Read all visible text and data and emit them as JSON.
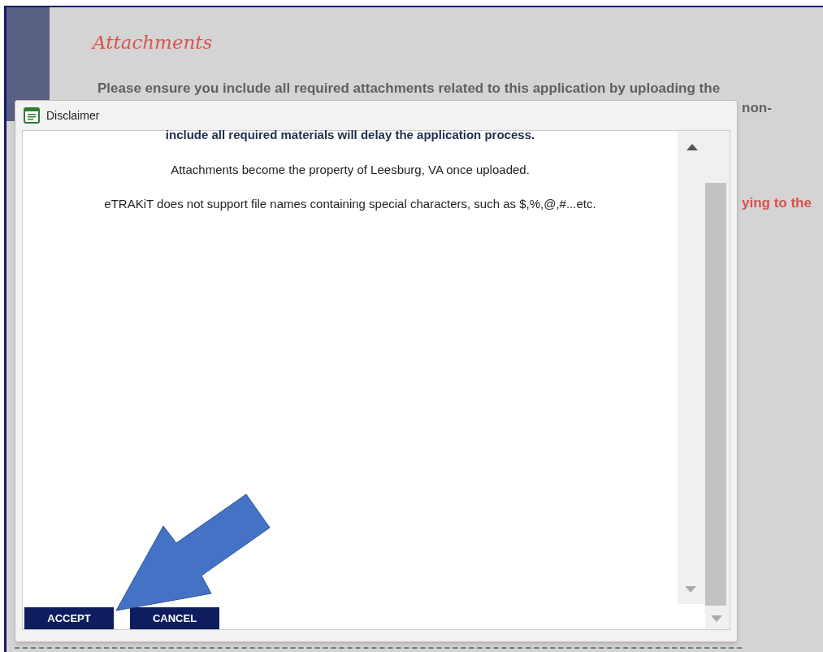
{
  "page": {
    "title": "Attachments",
    "intro_line": "Please ensure you include all required attachments related to this application by uploading the",
    "intro_tail": "non-",
    "notice_tail": "ying to the"
  },
  "dialog": {
    "title": "Disclaimer",
    "paragraphs": [
      {
        "text": "include all required materials will delay the application process.",
        "kind": "emphasis"
      },
      {
        "text": "Attachments become the property of Leesburg, VA once uploaded.",
        "kind": "plain"
      },
      {
        "text": "eTRAKiT does not support file names containing special characters, such as $,%,@,#...etc.",
        "kind": "plain"
      }
    ],
    "buttons": [
      "ACCEPT",
      "CANCEL"
    ]
  }
}
